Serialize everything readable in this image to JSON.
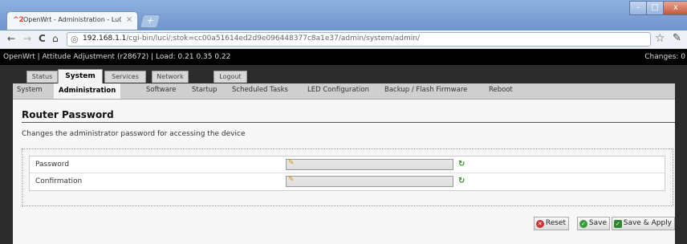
{
  "window": {
    "tab_title": "OpenWrt - Administration - LuCI",
    "tab_favicon_glyph": "^2",
    "tab_close_glyph": "×",
    "newtab_glyph": "+",
    "min_glyph": "–",
    "max_glyph": "□",
    "close_glyph": "x"
  },
  "toolbar": {
    "back_glyph": "←",
    "forward_glyph": "→",
    "reload_glyph": "C",
    "home_glyph": "⌂",
    "url_host": "192.168.1.1",
    "url_path": "/cgi-bin/luci/;stok=cc00a51614ed2d9e096448377c8a1e37/admin/system/admin/",
    "star_glyph": "☆",
    "wrench_glyph": "🔧"
  },
  "header": {
    "info": "OpenWrt | Attitude Adjustment (r28672) | Load: 0.21 0.35 0.22",
    "changes": "Changes: 0"
  },
  "menu": {
    "tabs": [
      "Status",
      "System",
      "Services",
      "Network",
      "Logout"
    ]
  },
  "submenu": {
    "tabs": [
      "System",
      "Administration",
      "Software",
      "Startup",
      "Scheduled Tasks",
      "LED Configuration",
      "Backup / Flash Firmware",
      "Reboot"
    ]
  },
  "content": {
    "title": "Router Password",
    "description": "Changes the administrator password for accessing the device",
    "fields": [
      {
        "label": "Password",
        "value": ""
      },
      {
        "label": "Confirmation",
        "value": ""
      }
    ]
  },
  "actions": {
    "reset": "Reset",
    "save": "Save",
    "save_apply": "Save & Apply"
  },
  "colors": {
    "accent_green": "#3b9b3b",
    "reset_red": "#cc3333",
    "header_bg": "#000000"
  },
  "icons": {
    "key": "key-icon",
    "reveal": "reveal-password-icon"
  }
}
